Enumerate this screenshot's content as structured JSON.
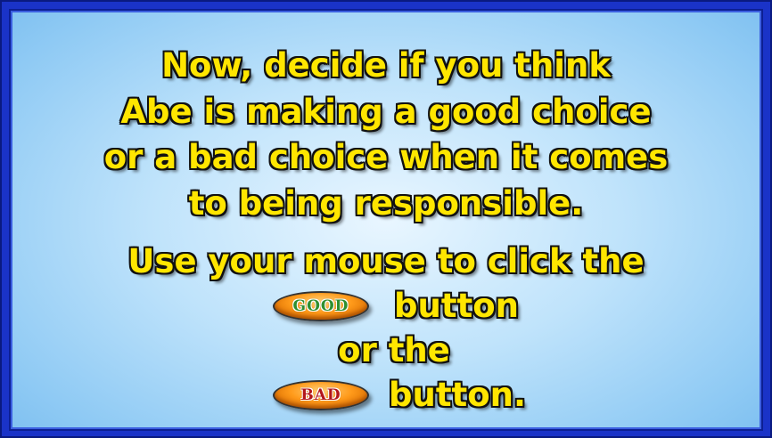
{
  "prompt": {
    "line1": "Now, decide if you think",
    "line2": "Abe is making a good choice",
    "line3": "or a bad choice when it comes",
    "line4": "to being responsible.",
    "line5": "Use your mouse to click the",
    "after_good": "button",
    "line7": "or the",
    "after_bad": "button."
  },
  "buttons": {
    "good_label": "GOOD",
    "bad_label": "BAD"
  },
  "colors": {
    "text": "#ffe600",
    "outline": "#111111",
    "frame": "#1a33c8",
    "background_center": "#e9f6ff",
    "background_edge": "#7dbff0",
    "button_orange": "#ff9a1a",
    "good_text": "#2f8f2f",
    "bad_text": "#b3161a"
  }
}
